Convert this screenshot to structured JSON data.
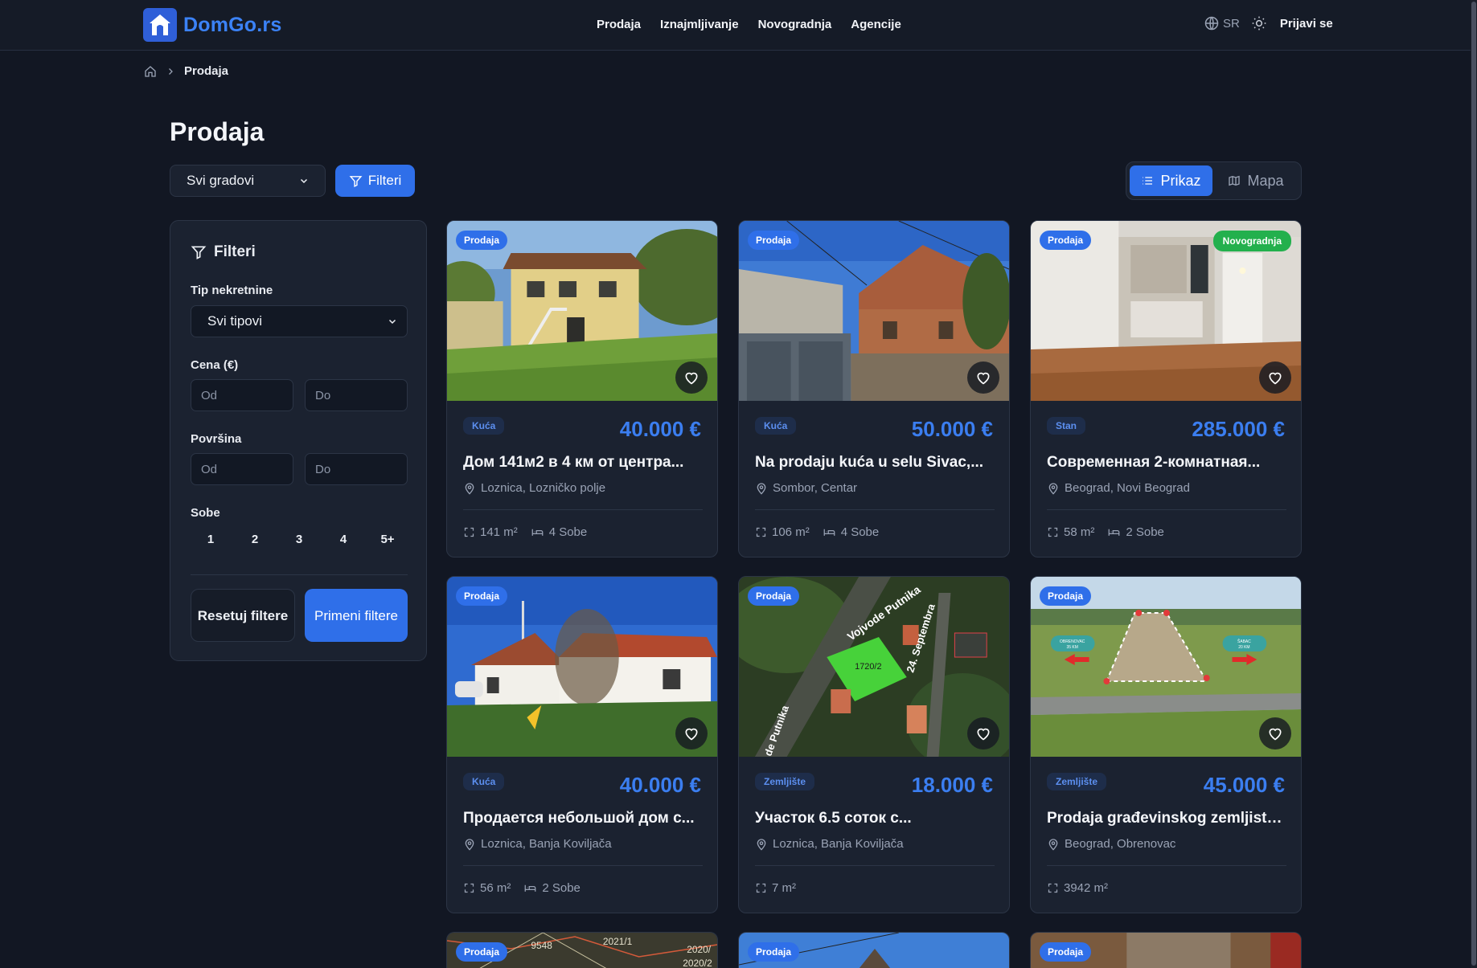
{
  "header": {
    "logo_text": "DomGo.rs",
    "nav": [
      "Prodaja",
      "Iznajmljivanje",
      "Novogradnja",
      "Agencije"
    ],
    "lang": "SR",
    "login": "Prijavi se"
  },
  "breadcrumb": {
    "current": "Prodaja"
  },
  "page": {
    "title": "Prodaja",
    "city_select": "Svi gradovi",
    "filters_button": "Filteri",
    "view_list": "Prikaz",
    "view_map": "Mapa"
  },
  "filters": {
    "heading": "Filteri",
    "type_label": "Tip nekretnine",
    "type_value": "Svi tipovi",
    "price_label": "Cena (€)",
    "area_label": "Površina",
    "from_placeholder": "Od",
    "to_placeholder": "Do",
    "rooms_label": "Sobe",
    "rooms": [
      "1",
      "2",
      "3",
      "4",
      "5+"
    ],
    "reset": "Resetuj filtere",
    "apply": "Primeni filtere"
  },
  "listings": [
    {
      "badge": "Prodaja",
      "type": "Kuća",
      "price": "40.000 €",
      "title": "Дом 141м2 в 4 км от центра...",
      "location": "Loznica, Lozničko polje",
      "area": "141 m²",
      "rooms": "4 Sobe"
    },
    {
      "badge": "Prodaja",
      "type": "Kuća",
      "price": "50.000 €",
      "title": "Na prodaju kuća u selu Sivac,...",
      "location": "Sombor, Centar",
      "area": "106 m²",
      "rooms": "4 Sobe"
    },
    {
      "badge": "Prodaja",
      "badge2": "Novogradnja",
      "type": "Stan",
      "price": "285.000 €",
      "title": "Современная 2-комнатная...",
      "location": "Beograd, Novi Beograd",
      "area": "58 m²",
      "rooms": "2 Sobe"
    },
    {
      "badge": "Prodaja",
      "type": "Kuća",
      "price": "40.000 €",
      "title": "Продается небольшой дом с...",
      "location": "Loznica, Banja Koviljača",
      "area": "56 m²",
      "rooms": "2 Sobe"
    },
    {
      "badge": "Prodaja",
      "type": "Zemljište",
      "price": "18.000 €",
      "title": "Участок 6.5 соток с...",
      "location": "Loznica, Banja Koviljača",
      "area": "7 m²"
    },
    {
      "badge": "Prodaja",
      "type": "Zemljište",
      "price": "45.000 €",
      "title": "Prodaja građevinskog zemljista...",
      "location": "Beograd, Obrenovac",
      "area": "3942 m²"
    },
    {
      "badge": "Prodaja"
    },
    {
      "badge": "Prodaja"
    },
    {
      "badge": "Prodaja"
    }
  ],
  "image_text": {
    "parcel": "1720/2",
    "street1": "Vojvode Putnika",
    "street2": "24. Septembra",
    "street3": "de Putnika",
    "sign_left": "OBRENOVAC",
    "sign_left_km": "35 KM",
    "sign_right": "ŠABAC",
    "sign_right_km": "20 KM",
    "map1": "9548",
    "map2": "2021/1",
    "map3": "2020/",
    "map4": "2020/2"
  }
}
